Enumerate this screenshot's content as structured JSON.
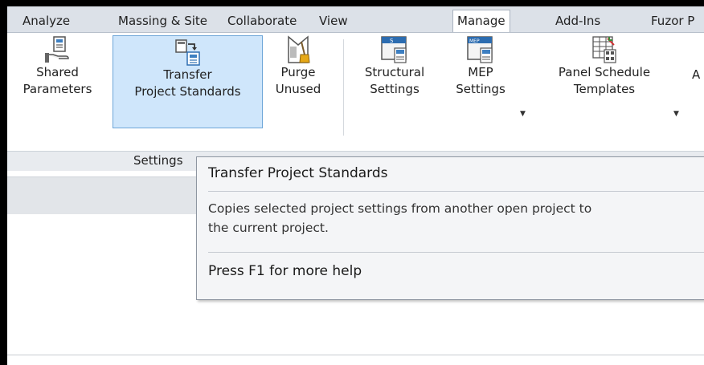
{
  "tabs": [
    {
      "label": "Analyze"
    },
    {
      "label": "Massing & Site"
    },
    {
      "label": "Collaborate"
    },
    {
      "label": "View"
    },
    {
      "label": "Manage"
    },
    {
      "label": "Add-Ins"
    },
    {
      "label": "Fuzor P"
    }
  ],
  "ribbon": {
    "buttons": [
      {
        "line1": "Shared",
        "line2": "Parameters",
        "icon": "shared-parameters-icon"
      },
      {
        "line1": "Transfer",
        "line2": "Project Standards",
        "icon": "transfer-project-standards-icon"
      },
      {
        "line1": "Purge",
        "line2": "Unused",
        "icon": "purge-unused-icon"
      },
      {
        "line1": "Structural",
        "line2": "Settings",
        "icon": "structural-settings-icon"
      },
      {
        "line1": "MEP",
        "line2": "Settings",
        "icon": "mep-settings-icon"
      },
      {
        "line1": "Panel Schedule",
        "line2": "Templates",
        "icon": "panel-schedule-templates-icon"
      },
      {
        "line1": "A",
        "line2": ""
      }
    ],
    "panel_caption": "Settings",
    "icon_texts": {
      "structural": "S",
      "mep": "MEP"
    }
  },
  "tooltip": {
    "title": "Transfer Project Standards",
    "description_line1": "Copies selected project settings from another open project to",
    "description_line2": "the current project.",
    "help": "Press F1 for more help"
  }
}
